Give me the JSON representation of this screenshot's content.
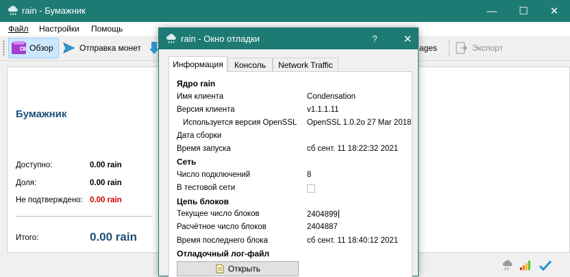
{
  "main_window": {
    "title": "rain - Бумажник",
    "controls": {
      "minimize": "—",
      "maximize": "☐",
      "close": "✕"
    }
  },
  "menu": {
    "file": "Файл",
    "settings": "Настройки",
    "help": "Помощь"
  },
  "toolbar": {
    "overview": "Обзор",
    "send": "Отправка монет",
    "messages_partial": "ages",
    "export": "Экспорт"
  },
  "wallet": {
    "heading": "Бумажник",
    "available_label": "Доступно:",
    "available_value": "0.00 rain",
    "stake_label": "Доля:",
    "stake_value": "0.00 rain",
    "unconfirmed_label": "Не подтверждено:",
    "unconfirmed_value": "0.00 rain",
    "total_label": "Итого:",
    "total_value": "0.00 rain"
  },
  "debug_window": {
    "title": "rain - Окно отладки",
    "help": "?",
    "close": "✕",
    "tabs": [
      "Информация",
      "Консоль",
      "Network Traffic"
    ],
    "info": {
      "core_heading": "Ядро rain",
      "client_name_label": "Имя клиента",
      "client_name_value": "Condensation",
      "client_version_label": "Версия клиента",
      "client_version_value": "v1.1.1.11",
      "openssl_label": "Используется версия OpenSSL",
      "openssl_value": "OpenSSL 1.0.2o  27 Mar 2018",
      "build_date_label": "Дата сборки",
      "build_date_value": "",
      "startup_label": "Время запуска",
      "startup_value": "сб сент. 11 18:22:32 2021",
      "network_heading": "Сеть",
      "connections_label": "Число подключений",
      "connections_value": "8",
      "testnet_label": "В тестовой сети",
      "blockchain_heading": "Цепь блоков",
      "current_blocks_label": "Текущее число блоков",
      "current_blocks_value": "2404899",
      "estimated_blocks_label": "Расчётное число блоков",
      "estimated_blocks_value": "2404887",
      "last_block_label": "Время последнего блока",
      "last_block_value": "сб сент. 11 18:40:12 2021",
      "logfile_heading": "Отладочный лог-файл",
      "open_button": "Открыть"
    }
  },
  "colors": {
    "titlebar": "#1e7b74",
    "accent_value": "#1f4f7a",
    "unconfirmed": "#d40000"
  }
}
